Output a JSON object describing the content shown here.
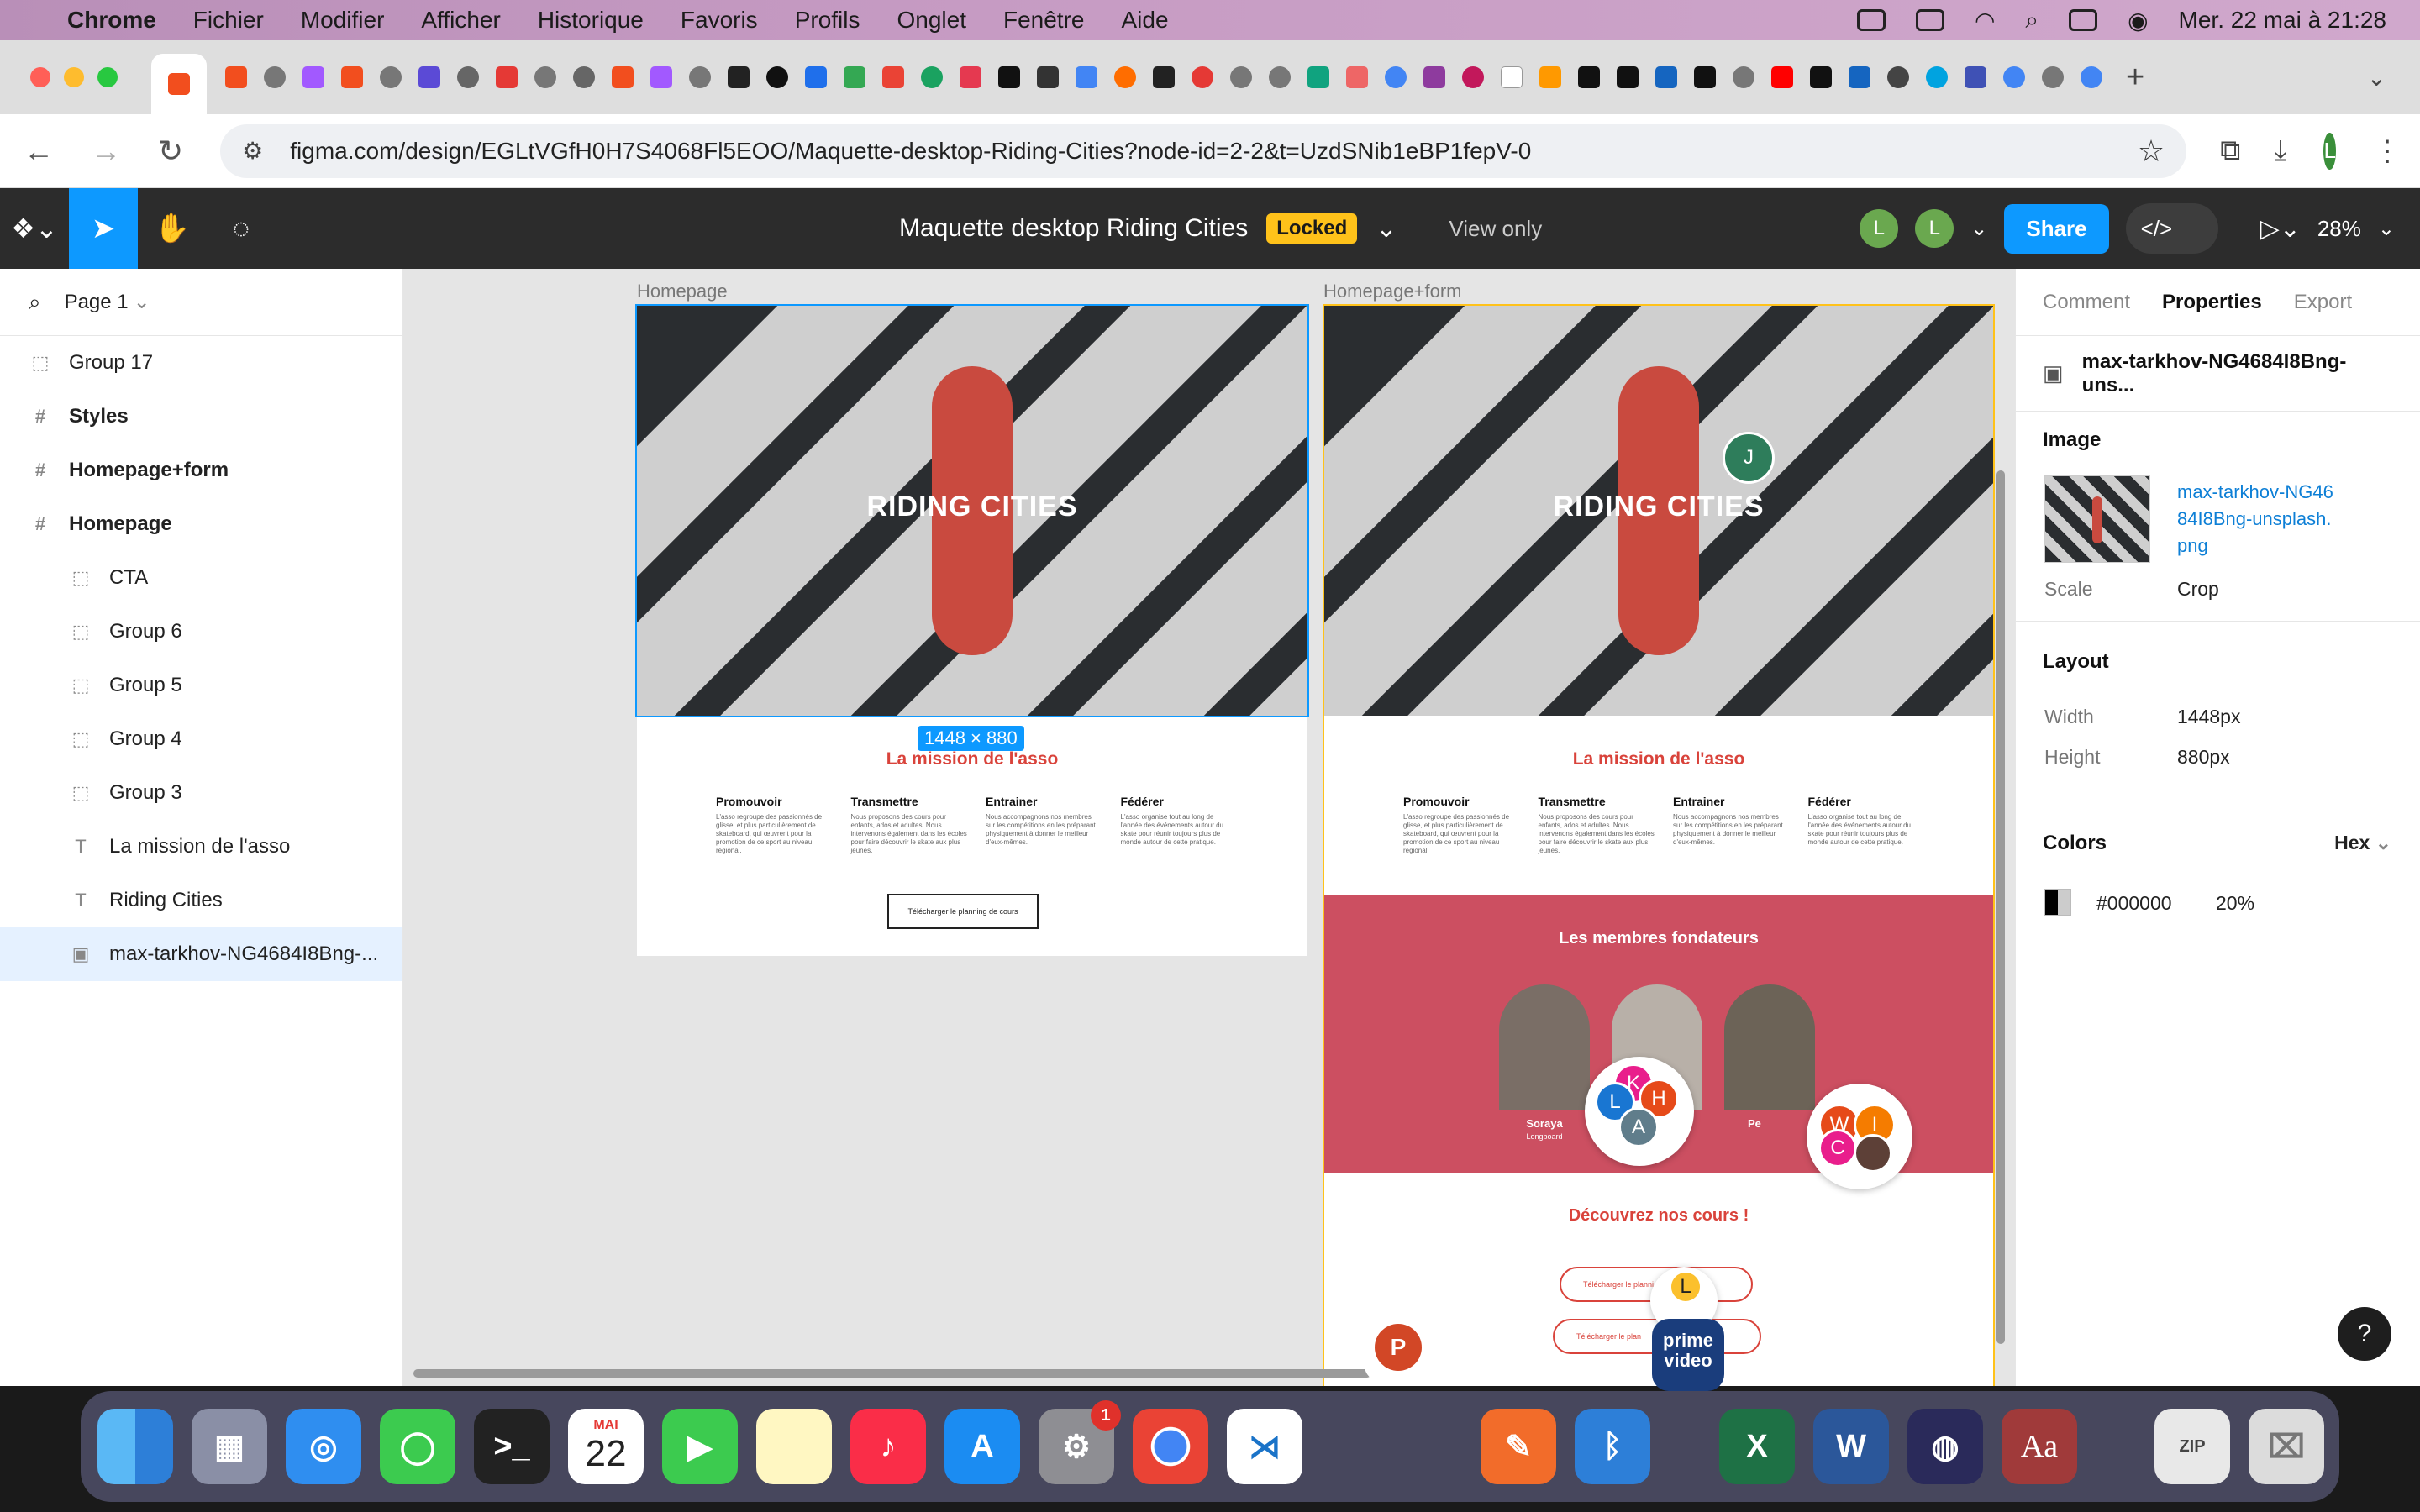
{
  "menubar": {
    "app": "Chrome",
    "items": [
      "Fichier",
      "Modifier",
      "Afficher",
      "Historique",
      "Favoris",
      "Profils",
      "Onglet",
      "Fenêtre",
      "Aide"
    ],
    "clock": "Mer. 22 mai à 21:28"
  },
  "browser": {
    "url": "figma.com/design/EGLtVGfH0H7S4068Fl5EOO/Maquette-desktop-Riding-Cities?node-id=2-2&t=UzdSNib1eBP1fepV-0",
    "profile_initial": "L",
    "new_tab": "+"
  },
  "figma": {
    "file_title": "Maquette desktop Riding Cities",
    "locked_badge": "Locked",
    "view_only": "View only",
    "avatars": [
      "L",
      "L"
    ],
    "share": "Share",
    "zoom": "28%"
  },
  "layers": {
    "page": "Page 1",
    "items": [
      {
        "label": "Group 17",
        "icon": "group-icon",
        "level": 0,
        "bold": false
      },
      {
        "label": "Styles",
        "icon": "frame-icon",
        "level": 0,
        "bold": true
      },
      {
        "label": "Homepage+form",
        "icon": "frame-icon",
        "level": 0,
        "bold": true
      },
      {
        "label": "Homepage",
        "icon": "frame-icon",
        "level": 0,
        "bold": true
      },
      {
        "label": "CTA",
        "icon": "group-icon",
        "level": 1,
        "bold": false
      },
      {
        "label": "Group 6",
        "icon": "group-icon",
        "level": 1,
        "bold": false
      },
      {
        "label": "Group 5",
        "icon": "group-icon",
        "level": 1,
        "bold": false
      },
      {
        "label": "Group 4",
        "icon": "group-icon",
        "level": 1,
        "bold": false
      },
      {
        "label": "Group 3",
        "icon": "group-icon",
        "level": 1,
        "bold": false
      },
      {
        "label": "La mission de l'asso",
        "icon": "text-icon",
        "level": 1,
        "bold": false
      },
      {
        "label": "Riding Cities",
        "icon": "text-icon",
        "level": 1,
        "bold": false
      },
      {
        "label": "max-tarkhov-NG4684I8Bng-...",
        "icon": "image-icon",
        "level": 1,
        "bold": false,
        "selected": true
      }
    ]
  },
  "canvas": {
    "frame1_label": "Homepage",
    "frame2_label": "Homepage+form",
    "size_badge": "1448 × 880",
    "hero_title": "RIDING CITIES",
    "mission_title": "La mission de l'asso",
    "columns": [
      {
        "title": "Promouvoir",
        "text": "L'asso regroupe des passionnés de glisse, et plus particulièrement de skateboard, qui œuvrent pour la promotion de ce sport au niveau régional."
      },
      {
        "title": "Transmettre",
        "text": "Nous proposons des cours pour enfants, ados et adultes. Nous intervenons également dans les écoles pour faire découvrir le skate aux plus jeunes."
      },
      {
        "title": "Entrainer",
        "text": "Nous accompagnons nos membres sur les compétitions en les préparant physiquement à donner le meilleur d'eux-mêmes."
      },
      {
        "title": "Fédérer",
        "text": "L'asso organise tout au long de l'année des événements autour du skate pour réunir toujours plus de monde autour de cette pratique."
      }
    ],
    "download_button": "Télécharger le planning de cours",
    "members_title": "Les membres fondateurs",
    "member1_name": "Soraya",
    "member1_role": "Longboard",
    "member3_name": "Pe",
    "courses_title": "Découvrez nos cours !",
    "pill1": "Télécharger le planni",
    "pill2": "Télécharger le plan",
    "cursor_avatar": "J",
    "cluster1": [
      "K",
      "H",
      "L",
      "A"
    ],
    "cluster2": [
      "W",
      "I",
      "C"
    ],
    "prime_label": "prime video",
    "ppt_label": "P"
  },
  "properties": {
    "tabs": [
      "Comment",
      "Properties",
      "Export"
    ],
    "active_tab": "Properties",
    "layer_name": "max-tarkhov-NG4684I8Bng-uns...",
    "image_heading": "Image",
    "image_file": "max-tarkhov-NG4684I8Bng-unsplash.png",
    "scale_label": "Scale",
    "scale_value": "Crop",
    "layout_heading": "Layout",
    "width_label": "Width",
    "width_value": "1448px",
    "height_label": "Height",
    "height_value": "880px",
    "colors_heading": "Colors",
    "color_format": "Hex",
    "color_hex": "#000000",
    "color_opacity": "20%",
    "help": "?"
  },
  "dock": {
    "calendar_month": "MAI",
    "calendar_day": "22",
    "settings_badge": "1",
    "word_label": "W",
    "excel_label": "X",
    "aa_label": "Aa"
  },
  "colors": {
    "figma_blue": "#0d99ff",
    "accent_red": "#d9433b",
    "members_bg": "#cc4f61",
    "locked_yellow": "#ffc21a"
  }
}
